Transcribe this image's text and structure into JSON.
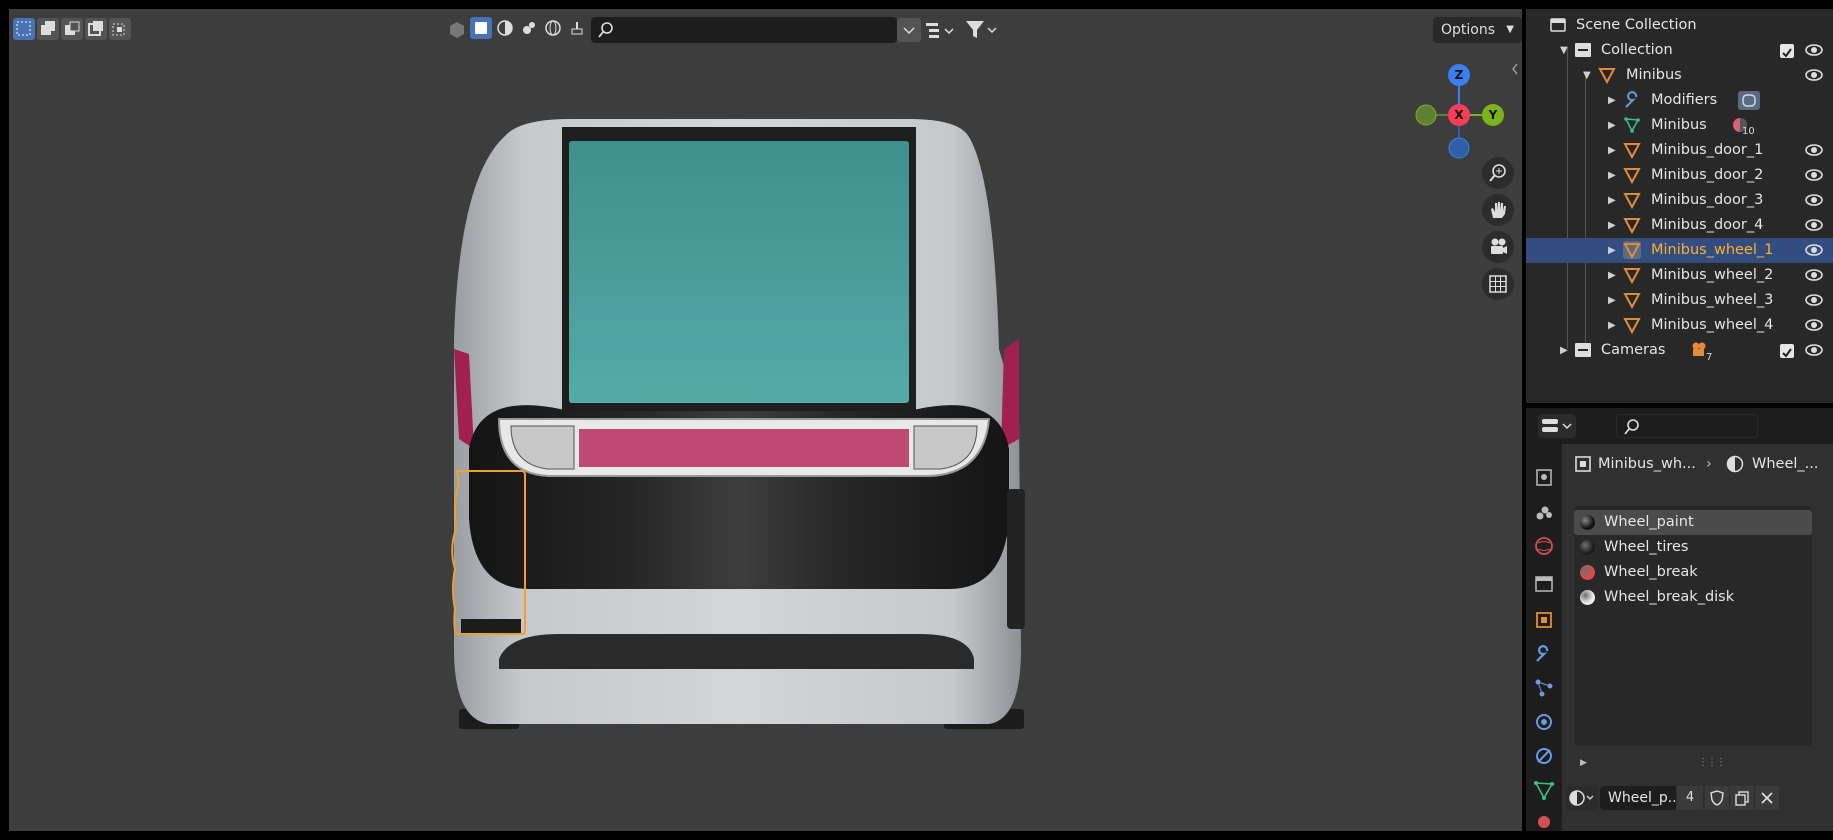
{
  "viewport": {
    "options_label": "Options",
    "search_placeholder": ""
  },
  "gizmo": {
    "z_label": "Z",
    "x_label": "X",
    "y_label": "Y",
    "colors": {
      "x": "#f63c57",
      "y": "#7bb31a",
      "z": "#3a7ff0"
    }
  },
  "outliner": {
    "scene_collection": "Scene Collection",
    "collection": "Collection",
    "minibus_object": "Minibus",
    "modifiers": "Modifiers",
    "mesh_data": "Minibus",
    "mesh_data_users": "10",
    "items": [
      {
        "label": "Minibus_door_1",
        "selected": false
      },
      {
        "label": "Minibus_door_2",
        "selected": false
      },
      {
        "label": "Minibus_door_3",
        "selected": false
      },
      {
        "label": "Minibus_door_4",
        "selected": false
      },
      {
        "label": "Minibus_wheel_1",
        "selected": true
      },
      {
        "label": "Minibus_wheel_2",
        "selected": false
      },
      {
        "label": "Minibus_wheel_3",
        "selected": false
      },
      {
        "label": "Minibus_wheel_4",
        "selected": false
      }
    ],
    "cameras": "Cameras",
    "cameras_count": "7"
  },
  "properties": {
    "search_placeholder": "",
    "breadcrumb_object": "Minibus_wh...",
    "breadcrumb_material": "Wheel_...",
    "materials": [
      {
        "name": "Wheel_paint",
        "color": "#111111",
        "active": true
      },
      {
        "name": "Wheel_tires",
        "color": "#1a1a1a",
        "active": false
      },
      {
        "name": "Wheel_break",
        "color": "#e04a4a",
        "active": false
      },
      {
        "name": "Wheel_break_disk",
        "color": "#f0f0f0",
        "active": false
      }
    ],
    "material_field": "Wheel_p...",
    "material_users": "4"
  }
}
